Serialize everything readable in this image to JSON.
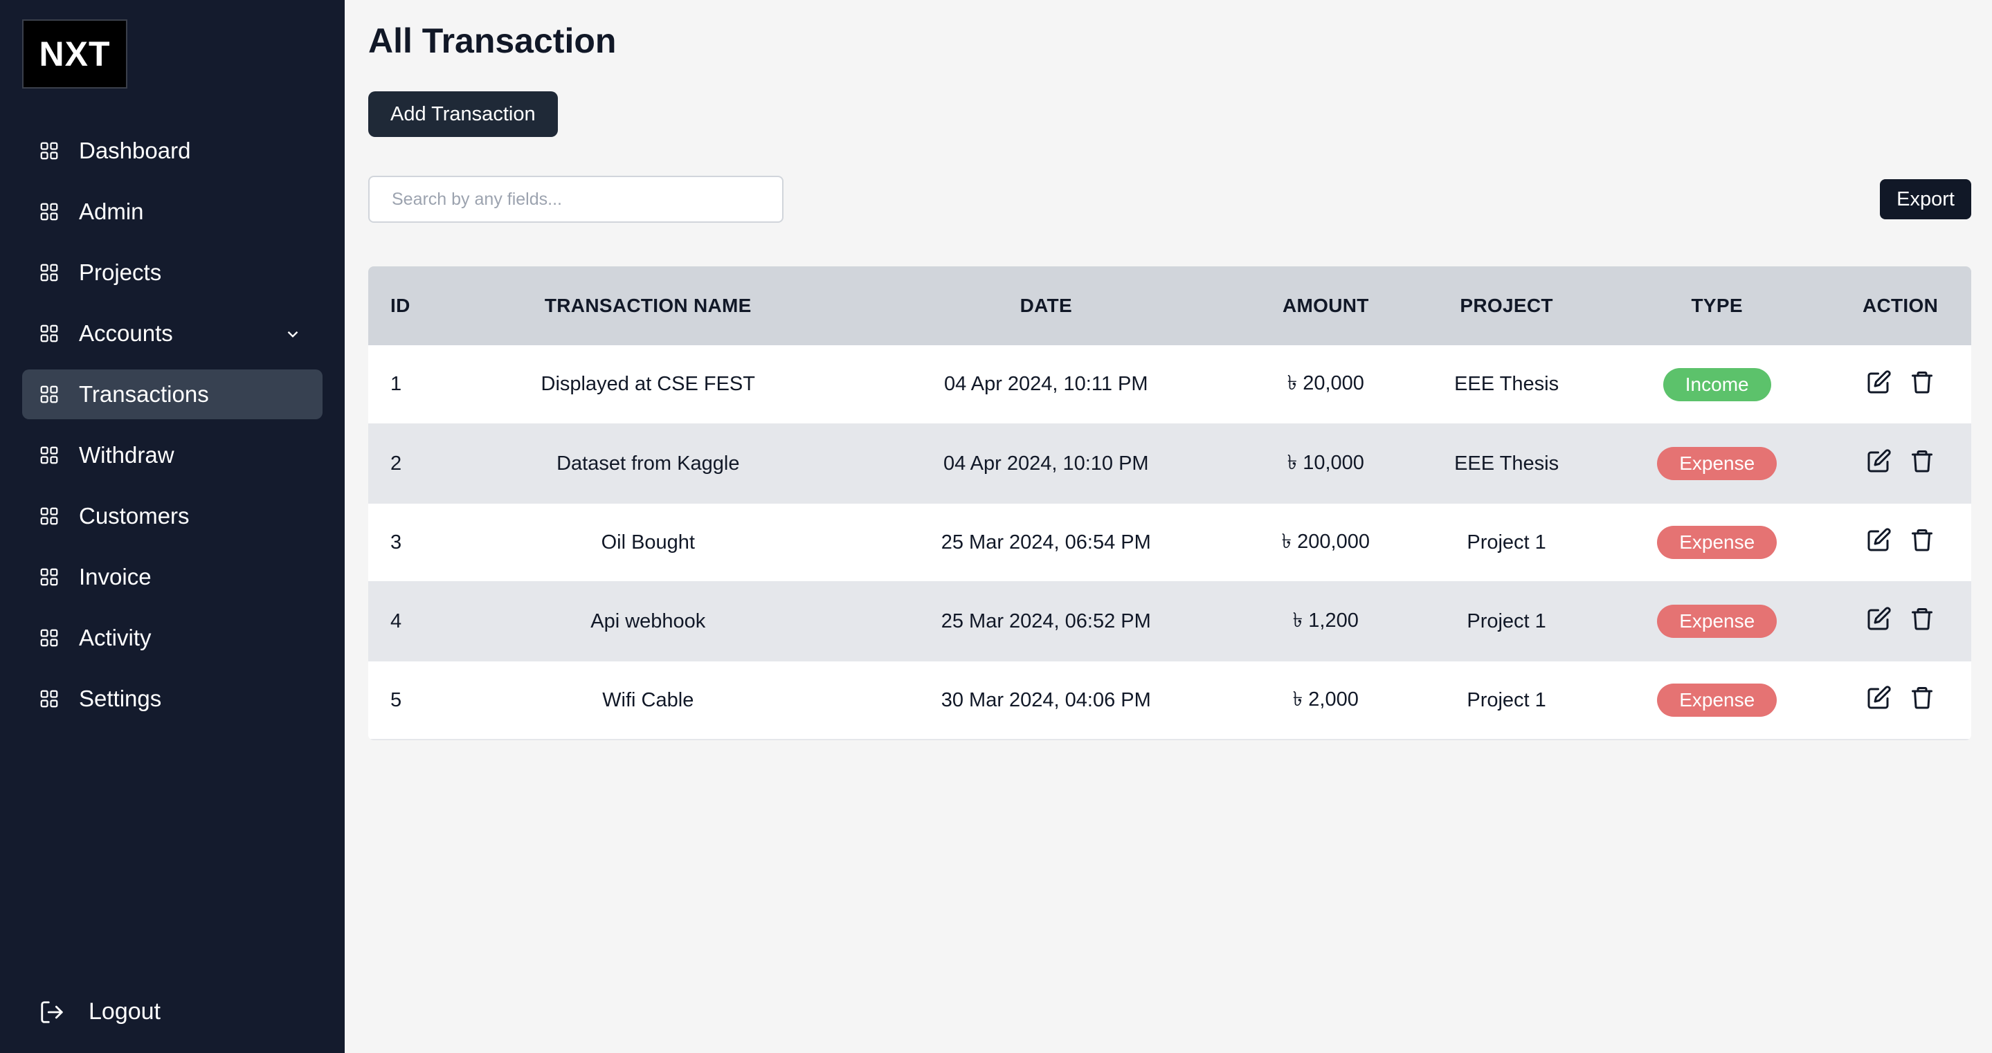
{
  "logo": "NXT",
  "sidebar": {
    "items": [
      {
        "label": "Dashboard",
        "active": false
      },
      {
        "label": "Admin",
        "active": false
      },
      {
        "label": "Projects",
        "active": false
      },
      {
        "label": "Accounts",
        "active": false,
        "expandable": true
      },
      {
        "label": "Transactions",
        "active": true
      },
      {
        "label": "Withdraw",
        "active": false
      },
      {
        "label": "Customers",
        "active": false
      },
      {
        "label": "Invoice",
        "active": false
      },
      {
        "label": "Activity",
        "active": false
      },
      {
        "label": "Settings",
        "active": false
      }
    ],
    "logout_label": "Logout",
    "icon": "grid-icon"
  },
  "main": {
    "title": "All Transaction",
    "add_button_label": "Add Transaction",
    "search_placeholder": "Search by any fields...",
    "export_label": "Export"
  },
  "table": {
    "headers": [
      "ID",
      "TRANSACTION NAME",
      "DATE",
      "AMOUNT",
      "PROJECT",
      "TYPE",
      "ACTION"
    ],
    "rows": [
      {
        "id": "1",
        "name": "Displayed at CSE FEST",
        "date": "04 Apr 2024, 10:11 PM",
        "amount": "৳ 20,000",
        "project": "EEE Thesis",
        "type": "Income"
      },
      {
        "id": "2",
        "name": "Dataset from Kaggle",
        "date": "04 Apr 2024, 10:10 PM",
        "amount": "৳ 10,000",
        "project": "EEE Thesis",
        "type": "Expense"
      },
      {
        "id": "3",
        "name": "Oil Bought",
        "date": "25 Mar 2024, 06:54 PM",
        "amount": "৳ 200,000",
        "project": "Project 1",
        "type": "Expense"
      },
      {
        "id": "4",
        "name": "Api webhook",
        "date": "25 Mar 2024, 06:52 PM",
        "amount": "৳ 1,200",
        "project": "Project 1",
        "type": "Expense"
      },
      {
        "id": "5",
        "name": "Wifi Cable",
        "date": "30 Mar 2024, 04:06 PM",
        "amount": "৳ 2,000",
        "project": "Project 1",
        "type": "Expense"
      }
    ]
  },
  "colors": {
    "sidebar_bg": "#141b2d",
    "active_item_bg": "#374151",
    "income": "#5cc26b",
    "expense": "#e57373",
    "header_bg": "#d1d5db"
  }
}
